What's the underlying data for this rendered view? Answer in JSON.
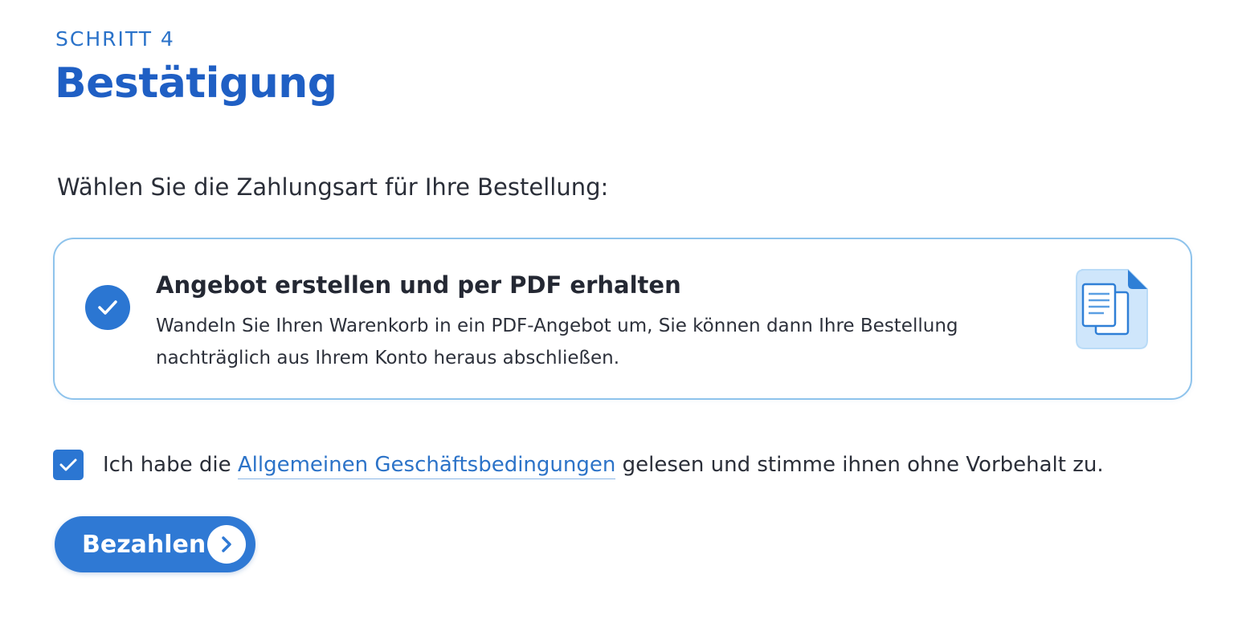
{
  "step": {
    "label": "SCHRITT 4"
  },
  "page": {
    "title": "Bestätigung"
  },
  "payment": {
    "prompt": "Wählen Sie die Zahlungsart für Ihre Bestellung:",
    "option": {
      "selected": true,
      "title": "Angebot erstellen und per PDF erhalten",
      "description": "Wandeln Sie Ihren Warenkorb in ein PDF-Angebot um, Sie können dann Ihre Bestellung nachträglich aus Ihrem Konto heraus abschließen.",
      "icon": "pdf-document-icon"
    }
  },
  "terms": {
    "checked": true,
    "prefix": "Ich habe die ",
    "link_text": "Allgemeinen Geschäftsbedingungen",
    "suffix": " gelesen und stimme ihnen ohne Vorbehalt zu."
  },
  "actions": {
    "pay_label": "Bezahlen",
    "pay_icon": "chevron-right-icon"
  },
  "colors": {
    "accent": "#2b76d2",
    "title": "#1f5fc4",
    "card_border": "#8ec3ec",
    "link": "#2c73c8"
  }
}
